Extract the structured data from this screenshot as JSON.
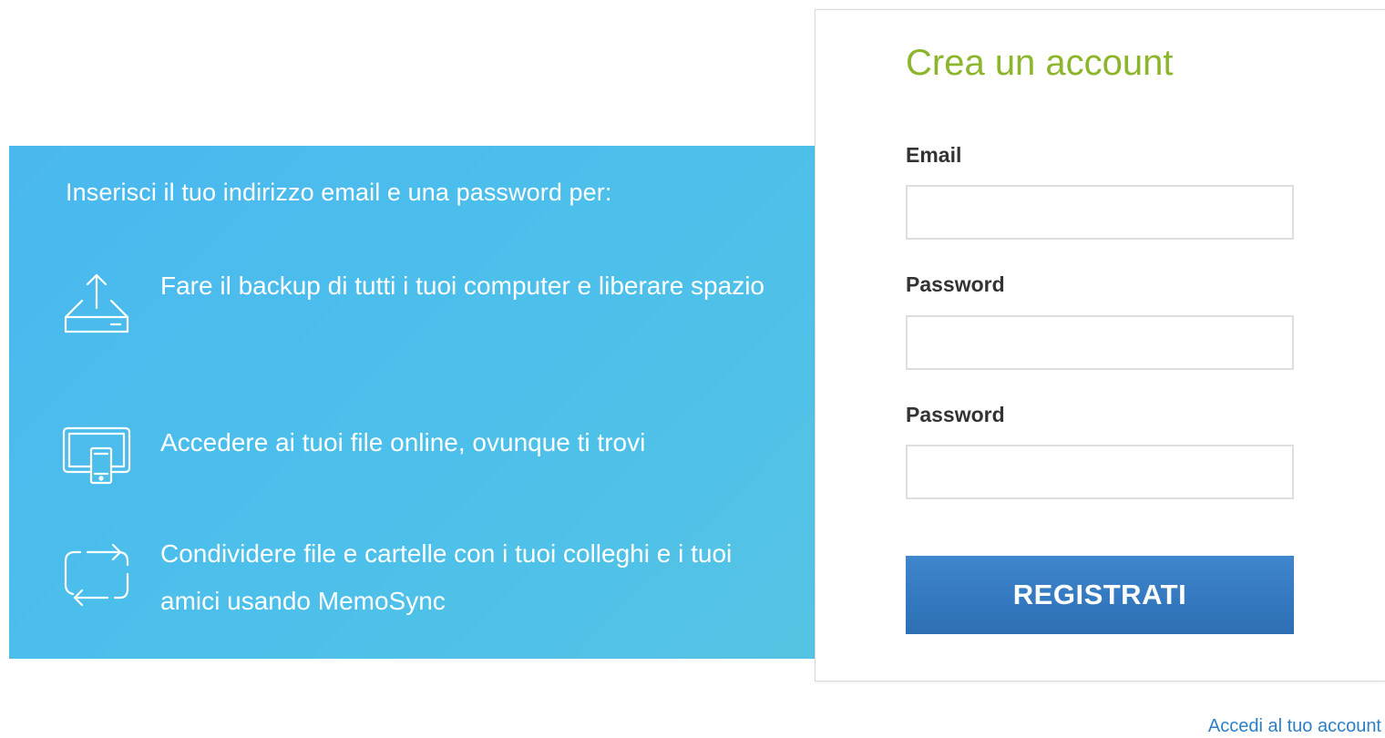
{
  "info_panel": {
    "intro": "Inserisci il tuo indirizzo email e una password per:",
    "features": [
      {
        "icon": "upload-drive-icon",
        "text": "Fare il backup di tutti i tuoi computer e liberare spazio"
      },
      {
        "icon": "devices-icon",
        "text": "Accedere ai tuoi file online, ovunque ti trovi"
      },
      {
        "icon": "sync-icon",
        "text": "Condividere file e cartelle con i tuoi colleghi e i tuoi amici usando MemoSync"
      }
    ],
    "background_color": "#4cbdec"
  },
  "form": {
    "title": "Crea un account",
    "title_color": "#8db52c",
    "fields": [
      {
        "label": "Email",
        "value": "",
        "placeholder": ""
      },
      {
        "label": "Password",
        "value": "",
        "placeholder": ""
      },
      {
        "label": "Password",
        "value": "",
        "placeholder": ""
      }
    ],
    "submit_label": "REGISTRATI",
    "button_color": "#3579c0"
  },
  "login_link": "Accedi al tuo account"
}
